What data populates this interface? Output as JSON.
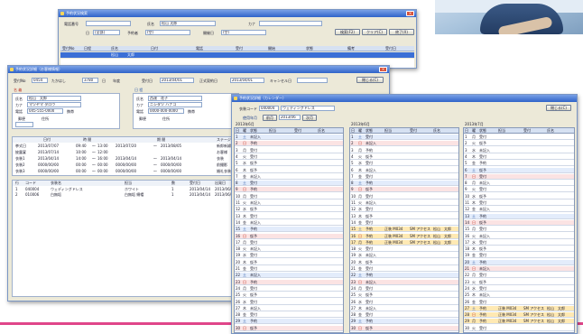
{
  "win1": {
    "title": "予約状況検索",
    "labels": [
      "電話番号",
      "氏名",
      "松山",
      "太郎",
      "カナ",
      "日",
      "[全部]",
      "予約者",
      "(空)",
      "開催日",
      "(空)"
    ],
    "buttons": [
      "検索(F2)",
      "クリア(C)",
      "終了(X)"
    ],
    "columns": [
      "受付No",
      "日程",
      "氏名",
      "日付",
      "電話",
      "受付",
      "開始",
      "状態",
      "備考",
      "受付日"
    ]
  },
  "win2": {
    "title": "予約状況詳細（お客様情報）",
    "top_labels": [
      "受付No",
      "0454",
      "たかはし",
      "3780",
      "日",
      "年度",
      "受付日",
      "2013/04/01",
      "正式契約日",
      "2013/04/01",
      "キャンセル日"
    ],
    "close_label": "閉じる(C)",
    "left_title": "名 義",
    "left_rows": [
      [
        "氏名",
        "松山　太郎"
      ],
      [
        "カナ",
        "マツヤマ タロウ"
      ],
      [
        "電話",
        "045-555-0000",
        "携帯"
      ],
      [
        "郵便",
        "住所"
      ]
    ],
    "right_title": "日 程",
    "right_rows": [
      [
        "氏名",
        "西達　花子"
      ],
      [
        "カナ",
        "ニシダツ ハナコ"
      ],
      [
        "電話",
        "0000-000-0000",
        "携帯"
      ],
      [
        "郵便",
        "住所"
      ]
    ],
    "sched_headers": [
      "日付",
      "時 間",
      "期 間",
      "ステージ"
    ],
    "sched_rows": [
      [
        "挙式日",
        "2013/07/07",
        "09:40",
        "～",
        "13:00",
        "2013/07/20",
        "～",
        "2013/08/05",
        "新郎新婦"
      ],
      [
        "披露宴",
        "2013/07/14",
        "10:00",
        "～",
        "12:00",
        "",
        "",
        "",
        "お客様"
      ],
      [
        "衣装1",
        "2013/04/14",
        "14:00",
        "～",
        "16:00",
        "2013/04/14",
        "～",
        "2013/04/14",
        "衣装"
      ],
      [
        "衣装2",
        "0000/00/00",
        "00:00",
        "～",
        "00:00",
        "0000/00/00",
        "～",
        "0000/00/00",
        "前撮影"
      ],
      [
        "衣装3",
        "0000/00/00",
        "00:00",
        "～",
        "00:00",
        "0000/00/00",
        "～",
        "0000/00/00",
        "婚礼衣装"
      ]
    ],
    "list_headers": [
      "行",
      "コード",
      "衣装名",
      "担当",
      "数",
      "受付日",
      "出発日"
    ],
    "list_rows": [
      [
        "1",
        "040004",
        "ウェディングドレス",
        "ホワイト",
        "1",
        "2013/04/14",
        "2013/06/1"
      ],
      [
        "2",
        "010006",
        "白無垢",
        "白無垢 綿帽",
        "1",
        "2013/04/14",
        "2013/06/1"
      ]
    ]
  },
  "win3": {
    "title": "予約状況詳細（カレンダー）",
    "code_label": "衣装コード",
    "code_value": "040004",
    "name_value": "ウェディングドレス",
    "close_label": "閉じる(C)",
    "month_label": "使用年月",
    "month_buttons": [
      "前月",
      "2013/06",
      "次月"
    ],
    "col_headers": [
      "日",
      "曜",
      "状態",
      "担当",
      "受付",
      "氏名"
    ],
    "months": [
      {
        "label": "2013年6月",
        "rows": [
          [
            "1",
            "土",
            "未記入"
          ],
          [
            "2",
            "日",
            "予約"
          ],
          [
            "3",
            "月",
            "受付"
          ],
          [
            "4",
            "火",
            "受付"
          ],
          [
            "5",
            "水",
            "仮予"
          ],
          [
            "6",
            "木",
            "仮予"
          ],
          [
            "7",
            "金",
            "未記入"
          ],
          [
            "8",
            "土",
            "受付"
          ],
          [
            "9",
            "日",
            "予約"
          ],
          [
            "10",
            "月",
            "受付"
          ],
          [
            "11",
            "火",
            "未記入"
          ],
          [
            "12",
            "水",
            "仮予"
          ],
          [
            "13",
            "木",
            "受付"
          ],
          [
            "14",
            "金",
            "未記入"
          ],
          [
            "15",
            "土",
            "予約"
          ],
          [
            "16",
            "日",
            "仮予"
          ],
          [
            "17",
            "月",
            "受付"
          ],
          [
            "18",
            "火",
            "未記入"
          ],
          [
            "19",
            "水",
            "受付"
          ],
          [
            "20",
            "木",
            "仮予"
          ],
          [
            "21",
            "金",
            "受付"
          ],
          [
            "22",
            "土",
            "未記入"
          ],
          [
            "23",
            "日",
            "予約"
          ],
          [
            "24",
            "月",
            "受付"
          ],
          [
            "25",
            "火",
            "仮予"
          ],
          [
            "26",
            "水",
            "受付"
          ],
          [
            "27",
            "木",
            "未記入"
          ],
          [
            "28",
            "金",
            "受付"
          ],
          [
            "29",
            "土",
            "予約"
          ],
          [
            "30",
            "日",
            "仮予"
          ]
        ]
      },
      {
        "label": "2013年6月",
        "rows": [
          [
            "1",
            "土",
            "受付"
          ],
          [
            "2",
            "日",
            "未記入"
          ],
          [
            "3",
            "月",
            "予約"
          ],
          [
            "4",
            "火",
            "仮予"
          ],
          [
            "5",
            "水",
            "受付"
          ],
          [
            "6",
            "木",
            "未記入"
          ],
          [
            "7",
            "金",
            "受付"
          ],
          [
            "8",
            "土",
            "予約"
          ],
          [
            "9",
            "日",
            "仮予"
          ],
          [
            "10",
            "月",
            "受付"
          ],
          [
            "11",
            "火",
            "未記入"
          ],
          [
            "12",
            "水",
            "受付"
          ],
          [
            "13",
            "木",
            "仮予"
          ],
          [
            "14",
            "金",
            "受付"
          ],
          [
            "15",
            "土",
            "予約",
            "正装 M034",
            "SM アクセス",
            "松山",
            "太郎"
          ],
          [
            "16",
            "日",
            "予約",
            "正装 M034",
            "SM アクセス",
            "松山",
            "太郎"
          ],
          [
            "17",
            "月",
            "予約",
            "正装 M034",
            "SM アクセス",
            "松山",
            "太郎"
          ],
          [
            "18",
            "火",
            "受付"
          ],
          [
            "19",
            "水",
            "未記入"
          ],
          [
            "20",
            "木",
            "仮予"
          ],
          [
            "21",
            "金",
            "受付"
          ],
          [
            "22",
            "土",
            "予約"
          ],
          [
            "23",
            "日",
            "未記入"
          ],
          [
            "24",
            "月",
            "受付"
          ],
          [
            "25",
            "火",
            "仮予"
          ],
          [
            "26",
            "水",
            "受付"
          ],
          [
            "27",
            "木",
            "未記入"
          ],
          [
            "28",
            "金",
            "受付"
          ],
          [
            "29",
            "土",
            "予約"
          ],
          [
            "30",
            "日",
            "仮予"
          ]
        ]
      },
      {
        "label": "2013年7月",
        "rows": [
          [
            "1",
            "月",
            "受付"
          ],
          [
            "2",
            "火",
            "仮予"
          ],
          [
            "3",
            "水",
            "未記入"
          ],
          [
            "4",
            "木",
            "受付"
          ],
          [
            "5",
            "金",
            "予約"
          ],
          [
            "6",
            "土",
            "仮予"
          ],
          [
            "7",
            "日",
            "受付"
          ],
          [
            "8",
            "月",
            "未記入"
          ],
          [
            "9",
            "火",
            "受付"
          ],
          [
            "10",
            "水",
            "仮予"
          ],
          [
            "11",
            "木",
            "受付"
          ],
          [
            "12",
            "金",
            "未記入"
          ],
          [
            "13",
            "土",
            "予約"
          ],
          [
            "14",
            "日",
            "仮予"
          ],
          [
            "15",
            "月",
            "受付"
          ],
          [
            "16",
            "火",
            "未記入"
          ],
          [
            "17",
            "水",
            "受付"
          ],
          [
            "18",
            "木",
            "仮予"
          ],
          [
            "19",
            "金",
            "受付"
          ],
          [
            "20",
            "土",
            "予約"
          ],
          [
            "21",
            "日",
            "未記入"
          ],
          [
            "22",
            "月",
            "受付"
          ],
          [
            "23",
            "火",
            "仮予"
          ],
          [
            "24",
            "水",
            "受付"
          ],
          [
            "25",
            "木",
            "未記入"
          ],
          [
            "26",
            "金",
            "受付"
          ],
          [
            "27",
            "土",
            "予約",
            "正装 M034",
            "SM アクセス",
            "松山",
            "太郎"
          ],
          [
            "28",
            "日",
            "予約",
            "正装 M034",
            "SM アクセス",
            "松山",
            "太郎"
          ],
          [
            "29",
            "月",
            "予約",
            "正装 M034",
            "SM アクセス",
            "松山",
            "太郎"
          ],
          [
            "30",
            "火",
            "受付"
          ]
        ]
      }
    ]
  }
}
